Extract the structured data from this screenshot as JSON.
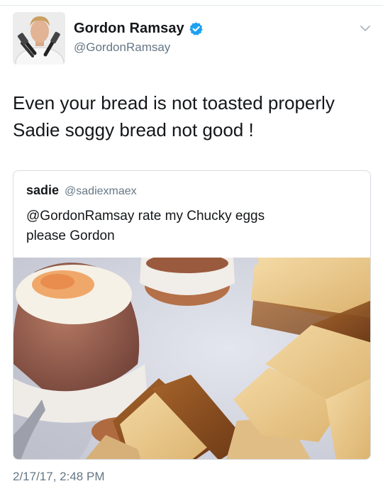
{
  "author": {
    "display_name": "Gordon Ramsay",
    "handle": "@GordonRamsay",
    "verified": true,
    "avatar_icon": "chef-portrait-avatar"
  },
  "tweet": {
    "text_lines": [
      "Even your bread is not toasted properly",
      "Sadie soggy bread not good !"
    ],
    "timestamp": "2/17/17, 2:48 PM"
  },
  "quoted_tweet": {
    "display_name": "sadie",
    "handle": "@sadiexmaex",
    "text_lines": [
      "@GordonRamsay rate my Chucky eggs",
      "please Gordon"
    ],
    "media": "photo of soft-boiled eggs in egg cups with toast soldiers"
  },
  "colors": {
    "text_primary": "#14171a",
    "text_secondary": "#657786",
    "verified_blue": "#1da1f2",
    "border": "#d8dde2"
  },
  "icons": {
    "verified": "verified-badge-icon",
    "menu": "chevron-down-icon"
  }
}
